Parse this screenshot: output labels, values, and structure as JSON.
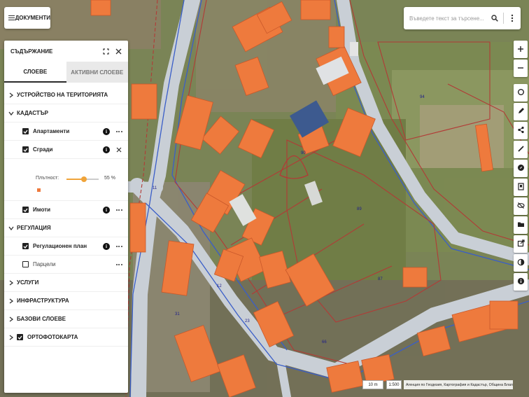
{
  "header": {
    "documents_label": "ДОКУМЕНТИ"
  },
  "search": {
    "placeholder": "Въведете текст за търсене..."
  },
  "panel": {
    "title": "СЪДЪРЖАНИЕ",
    "tabs": [
      {
        "label": "СЛОЕВЕ",
        "active": true
      },
      {
        "label": "АКТИВНИ СЛОЕВЕ",
        "active": false
      }
    ],
    "sections": {
      "territory": "УСТРОЙСТВО НА ТЕРИТОРИЯТА",
      "cadastre": "КАДАСТЪР",
      "regulation": "РЕГУЛАЦИЯ",
      "services": "УСЛУГИ",
      "infrastructure": "ИНФРАСТРУКТУРА",
      "base_layers": "БАЗОВИ СЛОЕВЕ",
      "orthophoto": "ОРТОФОТОКАРТА"
    },
    "layers": {
      "apartments": {
        "label": "Апартаменти",
        "checked": true
      },
      "buildings": {
        "label": "Сгради",
        "checked": true
      },
      "properties": {
        "label": "Имоти",
        "checked": true
      },
      "regulation_plan": {
        "label": "Регулационен план",
        "checked": true
      },
      "parcels": {
        "label": "Парцели",
        "checked": false
      }
    },
    "opacity": {
      "label": "Плътност:",
      "value": 55,
      "value_text": "55 %"
    }
  },
  "map": {
    "scale_text": "10 m",
    "ratio_text": "1:500",
    "attribution": "Агенция по Геодезия, Картография и Кадастър, Община Благоевград",
    "colors": {
      "building_fill": "#ee7a3d",
      "road": "#c9cfd6",
      "property_line": "#b23a36",
      "regulation_line": "#3a5ec8"
    }
  },
  "toolbar": {
    "tools": [
      "zoom-in-icon",
      "zoom-out-icon",
      "target-icon",
      "pencil-icon",
      "share-icon",
      "edit-line-icon",
      "compass-icon",
      "bookmark-icon",
      "eye-off-icon",
      "folder-icon",
      "open-external-icon",
      "contrast-icon",
      "info-icon"
    ]
  }
}
